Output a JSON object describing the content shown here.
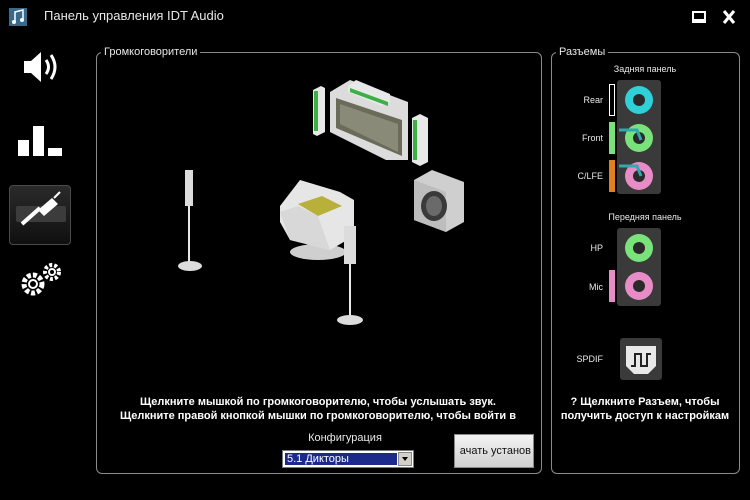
{
  "window": {
    "title": "Панель управления IDT Audio",
    "icons": [
      "music-note-icon",
      "minimize-icon",
      "close-icon"
    ]
  },
  "sidebar": {
    "items": [
      {
        "icon": "speaker-volume-icon",
        "active": false
      },
      {
        "icon": "equalizer-bars-icon",
        "active": false
      },
      {
        "icon": "audio-jack-icon",
        "active": true
      },
      {
        "icon": "gears-icon",
        "active": false
      }
    ]
  },
  "speakers": {
    "legend": "Громкоговорители",
    "hint_line1": "Щелкните мышкой по громкоговорителю, чтобы услышать звук.",
    "hint_line2": "Щелкните правой кнопкой мышки по громкоговорителю, чтобы войти в",
    "config_label": "Конфигурация",
    "config_value": "5.1 Дикторы",
    "setup_button": "ачать установ"
  },
  "jacks": {
    "legend": "Разъемы",
    "rear_title": "Задняя панель",
    "front_title": "Передняя панель",
    "rear": [
      {
        "label": "Rear",
        "color": "#2fd0d8"
      },
      {
        "label": "Front",
        "color": "#7ae27a"
      },
      {
        "label": "C/LFE",
        "color": "#e88cc8"
      }
    ],
    "front": [
      {
        "label": "HP",
        "color": "#7ae27a"
      },
      {
        "label": "Mic",
        "color": "#e88cc8"
      }
    ],
    "spdif_label": "SPDIF",
    "hint_line1": "? Щелкните Разъем, чтобы",
    "hint_line2": "получить доступ к настройкам"
  },
  "colors": {
    "background": "#000000",
    "panel_border": "#8a8a8a",
    "rear_jack": "#2fd0d8",
    "front_jack": "#7ae27a",
    "clfe_jack": "#e88cc8",
    "front_bar": "#7ae27a",
    "clfe_bar": "#e08020"
  }
}
